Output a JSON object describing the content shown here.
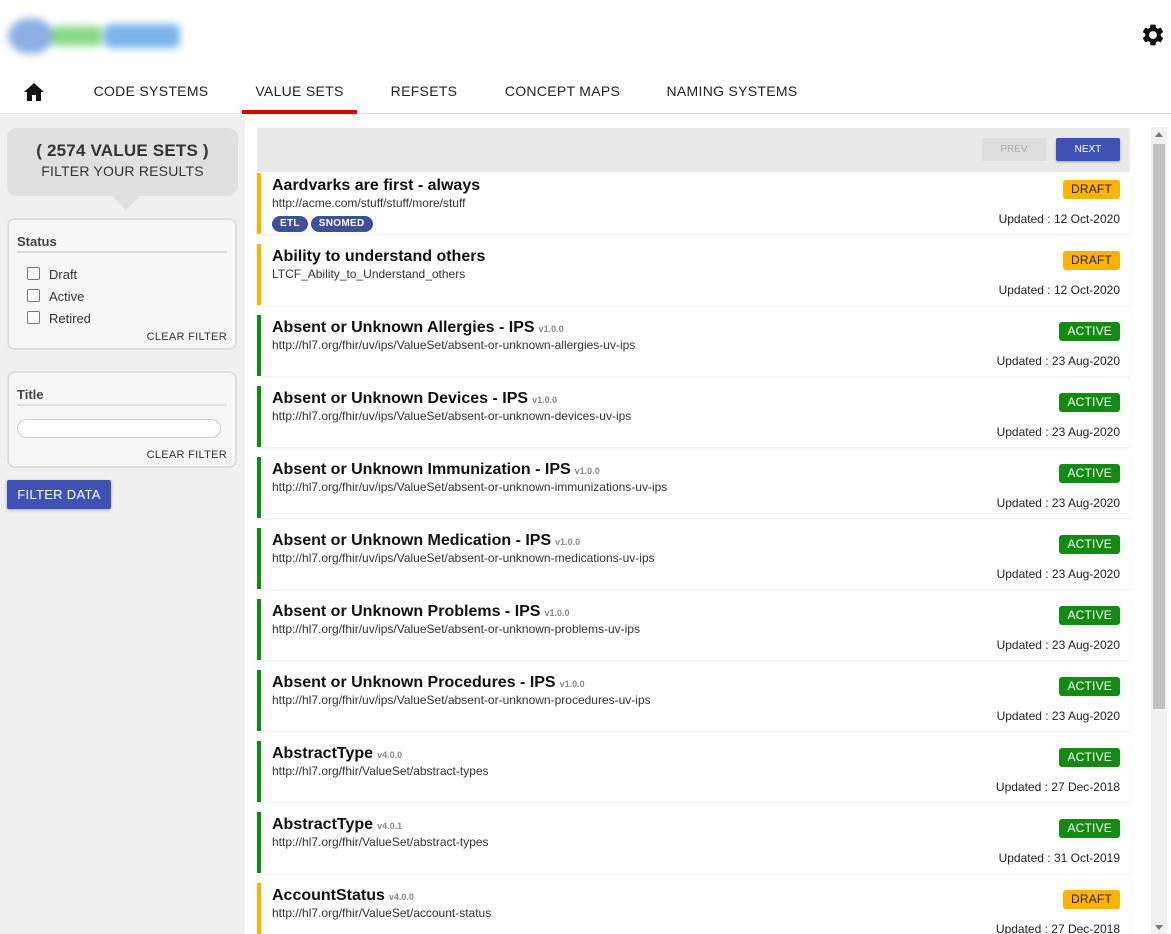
{
  "header": {
    "logo_icon": "blurred-logo",
    "settings_icon": "gear-icon"
  },
  "nav": {
    "home_icon": "home-icon",
    "tabs": [
      {
        "label": "CODE SYSTEMS"
      },
      {
        "label": "VALUE SETS"
      },
      {
        "label": "REFSETS"
      },
      {
        "label": "CONCEPT MAPS"
      },
      {
        "label": "NAMING SYSTEMS"
      }
    ],
    "active_tab": "VALUE SETS",
    "active_color": "#e00000"
  },
  "sidebar": {
    "count_title": "( 2574 VALUE SETS )",
    "count_subtitle": "FILTER YOUR RESULTS",
    "status_filter": {
      "heading": "Status",
      "options": [
        "Draft",
        "Active",
        "Retired"
      ],
      "clear_label": "CLEAR FILTER"
    },
    "title_filter": {
      "heading": "Title",
      "value": "",
      "clear_label": "CLEAR FILTER"
    },
    "filter_button": "FILTER DATA"
  },
  "pager": {
    "prev_label": "PREV",
    "next_label": "NEXT"
  },
  "colors": {
    "primary": "#3f51b5",
    "draft": "#ffb300",
    "active": "#138a13"
  },
  "value_sets": [
    {
      "title": "Aardvarks are first - always",
      "version": "",
      "url": "http://acme.com/stuff/stuff/more/stuff",
      "tags": [
        "ETL",
        "SNOMED"
      ],
      "status": "DRAFT",
      "updated": "Updated : 12 Oct-2020"
    },
    {
      "title": "Ability to understand others",
      "version": "",
      "url": "LTCF_Ability_to_Understand_others",
      "tags": [],
      "status": "DRAFT",
      "updated": "Updated : 12 Oct-2020"
    },
    {
      "title": "Absent or Unknown Allergies - IPS",
      "version": "v1.0.0",
      "url": "http://hl7.org/fhir/uv/ips/ValueSet/absent-or-unknown-allergies-uv-ips",
      "tags": [],
      "status": "ACTIVE",
      "updated": "Updated : 23 Aug-2020"
    },
    {
      "title": "Absent or Unknown Devices - IPS",
      "version": "v1.0.0",
      "url": "http://hl7.org/fhir/uv/ips/ValueSet/absent-or-unknown-devices-uv-ips",
      "tags": [],
      "status": "ACTIVE",
      "updated": "Updated : 23 Aug-2020"
    },
    {
      "title": "Absent or Unknown Immunization - IPS",
      "version": "v1.0.0",
      "url": "http://hl7.org/fhir/uv/ips/ValueSet/absent-or-unknown-immunizations-uv-ips",
      "tags": [],
      "status": "ACTIVE",
      "updated": "Updated : 23 Aug-2020"
    },
    {
      "title": "Absent or Unknown Medication - IPS",
      "version": "v1.0.0",
      "url": "http://hl7.org/fhir/uv/ips/ValueSet/absent-or-unknown-medications-uv-ips",
      "tags": [],
      "status": "ACTIVE",
      "updated": "Updated : 23 Aug-2020"
    },
    {
      "title": "Absent or Unknown Problems - IPS",
      "version": "v1.0.0",
      "url": "http://hl7.org/fhir/uv/ips/ValueSet/absent-or-unknown-problems-uv-ips",
      "tags": [],
      "status": "ACTIVE",
      "updated": "Updated : 23 Aug-2020"
    },
    {
      "title": "Absent or Unknown Procedures - IPS",
      "version": "v1.0.0",
      "url": "http://hl7.org/fhir/uv/ips/ValueSet/absent-or-unknown-procedures-uv-ips",
      "tags": [],
      "status": "ACTIVE",
      "updated": "Updated : 23 Aug-2020"
    },
    {
      "title": "AbstractType",
      "version": "v4.0.0",
      "url": "http://hl7.org/fhir/ValueSet/abstract-types",
      "tags": [],
      "status": "ACTIVE",
      "updated": "Updated : 27 Dec-2018"
    },
    {
      "title": "AbstractType",
      "version": "v4.0.1",
      "url": "http://hl7.org/fhir/ValueSet/abstract-types",
      "tags": [],
      "status": "ACTIVE",
      "updated": "Updated : 31 Oct-2019"
    },
    {
      "title": "AccountStatus",
      "version": "v4.0.0",
      "url": "http://hl7.org/fhir/ValueSet/account-status",
      "tags": [],
      "status": "DRAFT",
      "updated": "Updated : 27 Dec-2018"
    }
  ]
}
